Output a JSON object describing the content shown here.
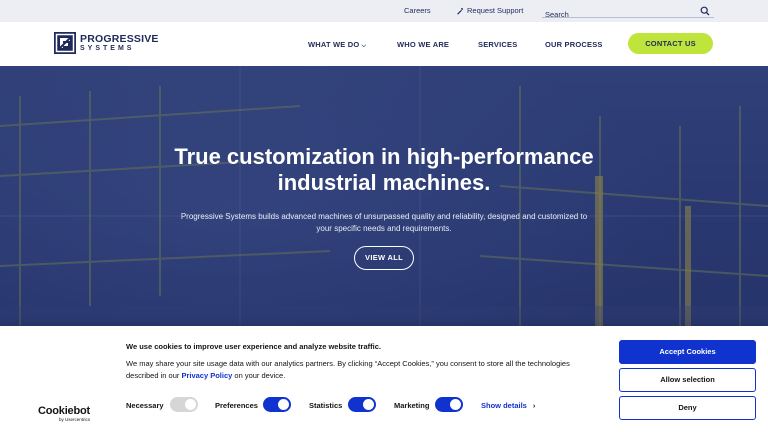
{
  "utility_bar": {
    "careers": "Careers",
    "request_support": "Request Support",
    "search_placeholder": "Search"
  },
  "logo": {
    "line1": "PROGRESSIVE",
    "line2": "SYSTEMS"
  },
  "nav": {
    "what_we_do": "WHAT WE DO",
    "who_we_are": "WHO WE ARE",
    "services": "SERVICES",
    "our_process": "OUR PROCESS",
    "contact_us": "CONTACT US"
  },
  "hero": {
    "title_line1": "True customization in high-performance",
    "title_line2": "industrial machines.",
    "subtitle": "Progressive Systems builds advanced machines of unsurpassed quality and reliability, designed and customized to your specific needs and requirements.",
    "cta": "VIEW ALL"
  },
  "cookie_banner": {
    "logo_main": "Cookiebot",
    "logo_sub": "by Usercentrics",
    "title": "We use cookies to improve user experience and analyze website traffic.",
    "text_before_link": "We may share your site usage data with our analytics partners. By clicking “Accept Cookies,” you consent to store all the technologies described in our ",
    "privacy_link": "Privacy Policy",
    "text_after_link": " on your device.",
    "toggles": {
      "necessary": {
        "label": "Necessary",
        "on": true,
        "disabled": true
      },
      "preferences": {
        "label": "Preferences",
        "on": true
      },
      "statistics": {
        "label": "Statistics",
        "on": true
      },
      "marketing": {
        "label": "Marketing",
        "on": true
      }
    },
    "show_details": "Show details",
    "accept": "Accept Cookies",
    "allow_selection": "Allow selection",
    "deny": "Deny"
  },
  "colors": {
    "navy": "#1f2a5a",
    "lime": "#bfe43c",
    "cookie_blue": "#1032cf"
  }
}
